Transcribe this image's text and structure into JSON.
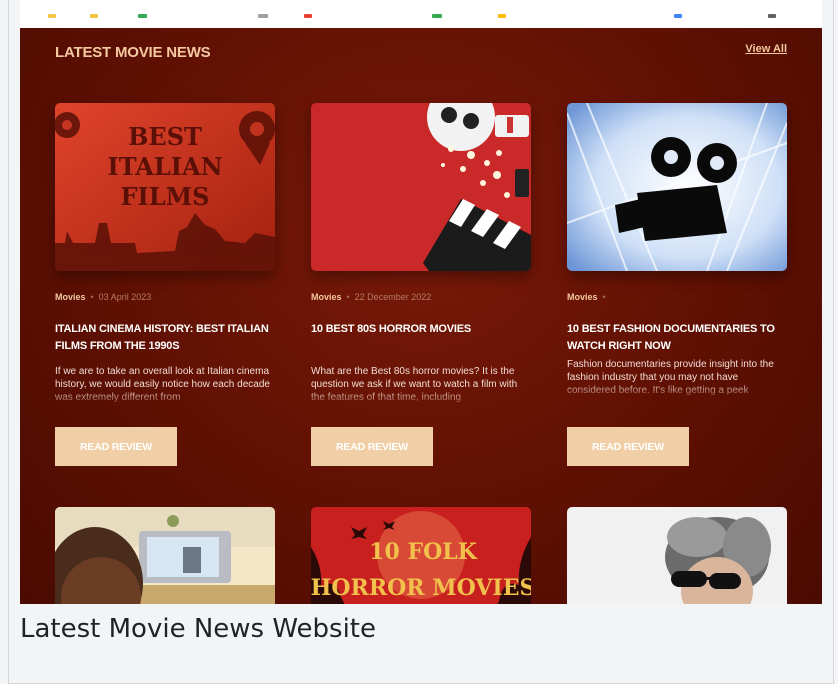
{
  "section": {
    "title": "LATEST MOVIE NEWS",
    "view_all": "View All"
  },
  "cards": [
    {
      "category": "Movies",
      "date": "03 April 2023",
      "title": "Italian Cinema History: Best Italian Films from the 1990s",
      "excerpt": "If we are to take an overall look at Italian cinema history, we would easily notice how each decade was extremely different from",
      "button": "Read Review",
      "thumb_text": [
        "BEST",
        "ITALIAN",
        "FILMS"
      ]
    },
    {
      "category": "Movies",
      "date": "22 December 2022",
      "title": "10 Best 80s Horror Movies",
      "excerpt": "What are the Best 80s horror movies? It is the question we ask if we want to watch a film with the features of that time, including",
      "button": "Read Review"
    },
    {
      "category": "Movies",
      "date": "",
      "title": "10 Best Fashion Documentaries to Watch Right Now",
      "excerpt": "Fashion documentaries provide insight into the fashion industry that you may not have considered before. It's like getting a peek",
      "button": "Read Review"
    }
  ],
  "row2": [
    {
      "thumb_text": []
    },
    {
      "thumb_text": [
        "10 FOLK",
        "HORROR MOVIES"
      ]
    },
    {
      "thumb_text": []
    }
  ],
  "caption": "Latest Movie News Website",
  "colors": {
    "background": "#5f1003",
    "accent": "#f4c9a0",
    "button": "#f1cfa6"
  }
}
